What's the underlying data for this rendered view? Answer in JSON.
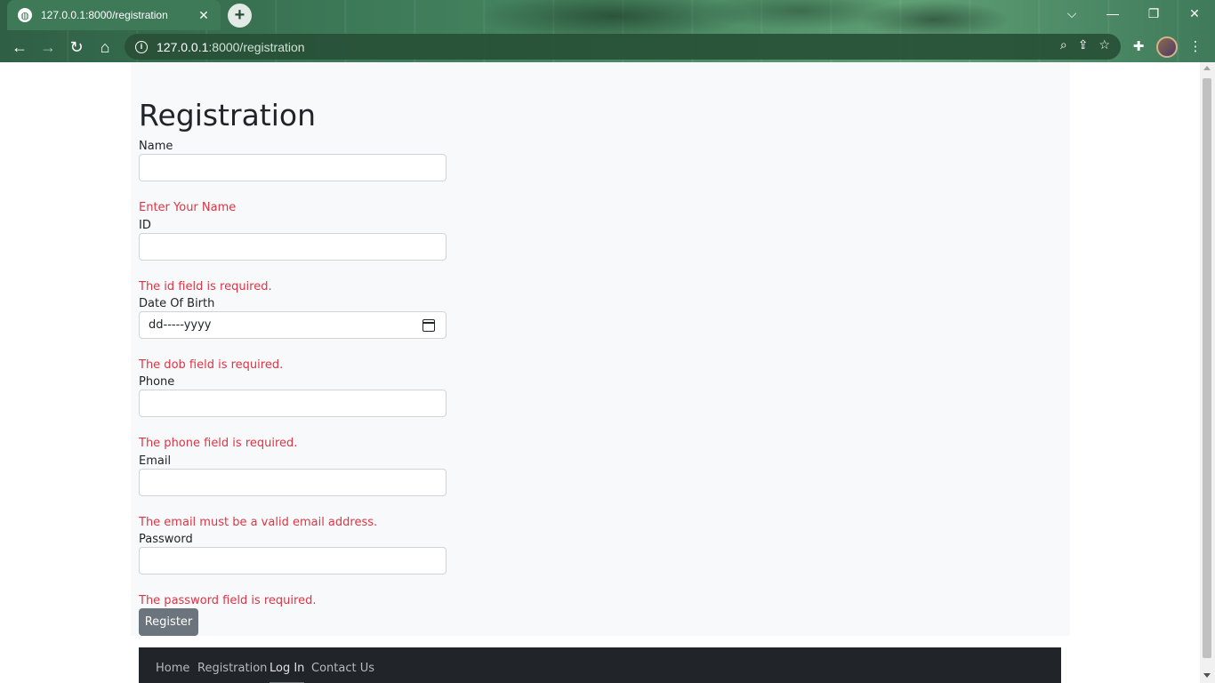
{
  "browser": {
    "tab_title": "127.0.0.1:8000/registration",
    "url_host": "127.0.0.1",
    "url_path": ":8000/registration"
  },
  "page": {
    "heading": "Registration",
    "fields": [
      {
        "label": "Name",
        "value": "",
        "error": "Enter Your Name"
      },
      {
        "label": "ID",
        "value": "",
        "error": "The id field is required."
      },
      {
        "label": "Date Of Birth",
        "value": "dd-----yyyy",
        "error": "The dob field is required."
      },
      {
        "label": "Phone",
        "value": "",
        "error": "The phone field is required."
      },
      {
        "label": "Email",
        "value": "",
        "error": "The email must be a valid email address."
      },
      {
        "label": "Password",
        "value": "",
        "error": "The password field is required."
      }
    ],
    "submit_label": "Register"
  },
  "footer": {
    "links": [
      "Home",
      "Registration",
      "Log In",
      "Contact Us"
    ]
  },
  "colors": {
    "error": "#dc3545",
    "button": "#6c757d",
    "footer_bg": "#212529"
  }
}
